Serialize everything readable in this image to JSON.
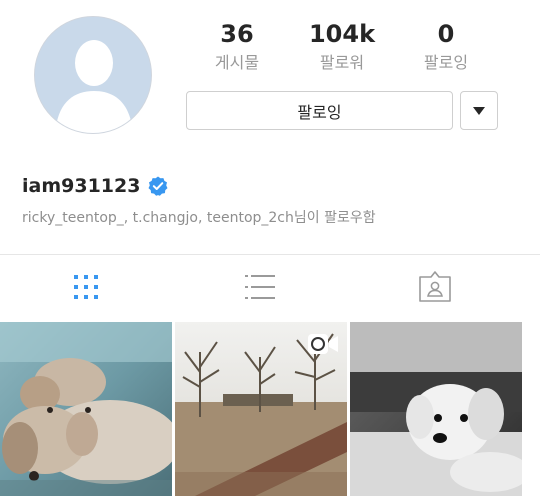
{
  "profile": {
    "username": "iam931123",
    "verified": true,
    "followed_by": "ricky_teentop_, t.changjo, teentop_2ch님이 팔로우함"
  },
  "stats": {
    "posts": {
      "value": "36",
      "label": "게시물"
    },
    "followers": {
      "value": "104k",
      "label": "팔로워"
    },
    "following": {
      "value": "0",
      "label": "팔로잉"
    }
  },
  "actions": {
    "follow_label": "팔로잉",
    "more_icon": "caret-down-icon"
  },
  "tabs": [
    {
      "name": "grid",
      "icon": "grid-icon",
      "active": true
    },
    {
      "name": "list",
      "icon": "list-icon",
      "active": false
    },
    {
      "name": "tagged",
      "icon": "tagged-person-icon",
      "active": false
    }
  ],
  "colors": {
    "accent": "#3897f0",
    "verified": "#3897f0",
    "muted_text": "#999999",
    "border": "#cfcfcf"
  },
  "posts": [
    {
      "kind": "photo",
      "subject": "two dogs lying down"
    },
    {
      "kind": "video",
      "subject": "park with bare trees",
      "icon": "video-camera-icon"
    },
    {
      "kind": "photo",
      "subject": "white dog on sofa"
    }
  ]
}
